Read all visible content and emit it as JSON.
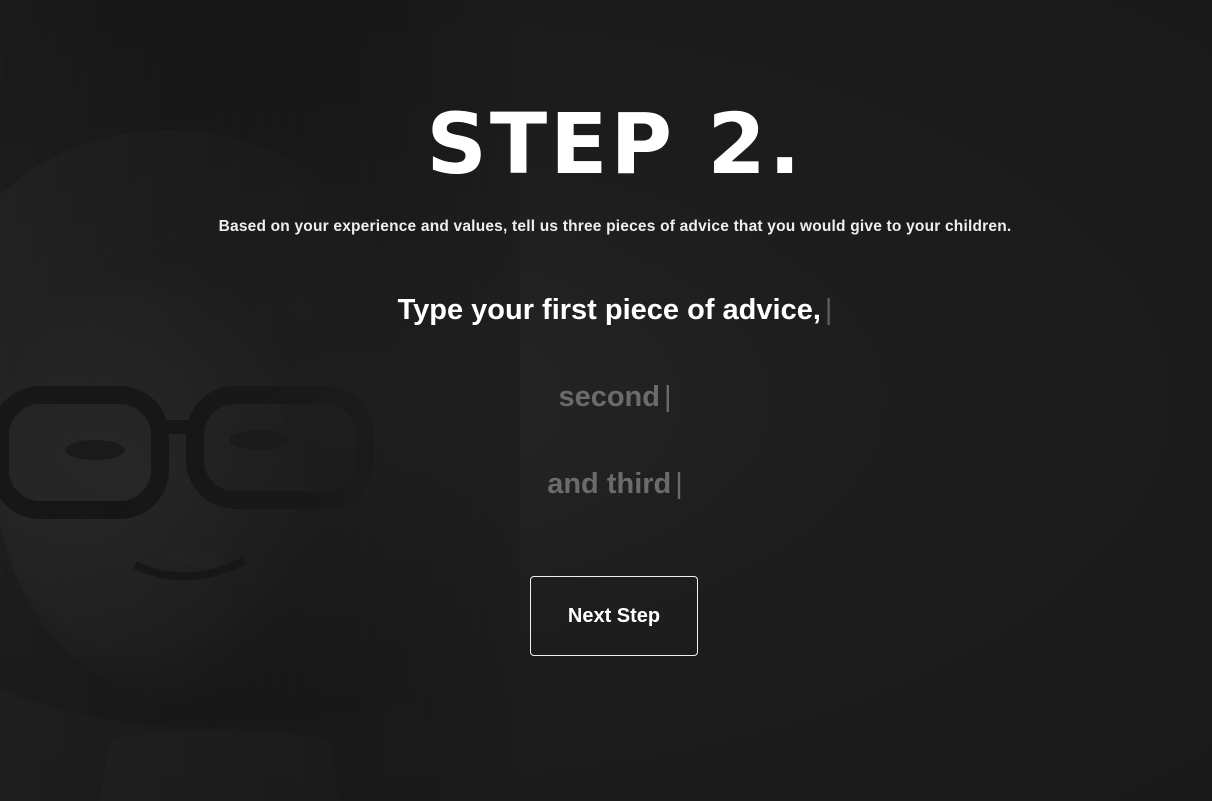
{
  "step": {
    "title": "STEP 2.",
    "instructions": "Based on your experience and values, tell us three pieces of advice that you would give to your children."
  },
  "advice": {
    "first_placeholder": "Type your first piece of advice,",
    "second_placeholder": "second",
    "third_placeholder": "and third",
    "caret": "|"
  },
  "actions": {
    "next_label": "Next Step"
  },
  "colors": {
    "background": "#1c1c1c",
    "text": "#ffffff",
    "placeholder": "#6b6b6b"
  },
  "icons": {
    "background": "child-portrait-photo"
  }
}
